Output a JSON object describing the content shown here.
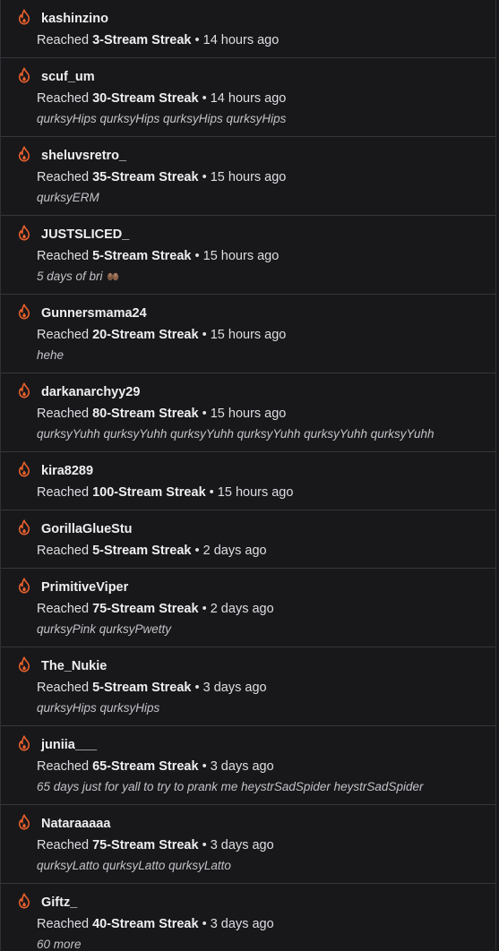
{
  "reached_label": "Reached",
  "separator": "•",
  "items": [
    {
      "username": "kashinzino",
      "streak": "3-Stream Streak",
      "time": "14 hours ago",
      "message": ""
    },
    {
      "username": "scuf_um",
      "streak": "30-Stream Streak",
      "time": "14 hours ago",
      "message": "qurksyHips qurksyHips qurksyHips qurksyHips"
    },
    {
      "username": "sheluvsretro_",
      "streak": "35-Stream Streak",
      "time": "15 hours ago",
      "message": "qurksyERM"
    },
    {
      "username": "JUSTSLICED_",
      "streak": "5-Stream Streak",
      "time": "15 hours ago",
      "message": "5 days of bri",
      "emoji": "praying-hands-emoji"
    },
    {
      "username": "Gunnersmama24",
      "streak": "20-Stream Streak",
      "time": "15 hours ago",
      "message": "hehe"
    },
    {
      "username": "darkanarchyy29",
      "streak": "80-Stream Streak",
      "time": "15 hours ago",
      "message": "qurksyYuhh qurksyYuhh qurksyYuhh qurksyYuhh qurksyYuhh qurksyYuhh"
    },
    {
      "username": "kira8289",
      "streak": "100-Stream Streak",
      "time": "15 hours ago",
      "message": ""
    },
    {
      "username": "GorillaGlueStu",
      "streak": "5-Stream Streak",
      "time": "2 days ago",
      "message": ""
    },
    {
      "username": "PrimitiveViper",
      "streak": "75-Stream Streak",
      "time": "2 days ago",
      "message": "qurksyPink qurksyPwetty"
    },
    {
      "username": "The_Nukie",
      "streak": "5-Stream Streak",
      "time": "3 days ago",
      "message": "qurksyHips qurksyHips"
    },
    {
      "username": "juniia___",
      "streak": "65-Stream Streak",
      "time": "3 days ago",
      "message": "65 days just for yall to try to prank me heystrSadSpider heystrSadSpider"
    },
    {
      "username": "Nataraaaaa",
      "streak": "75-Stream Streak",
      "time": "3 days ago",
      "message": "qurksyLatto qurksyLatto qurksyLatto"
    },
    {
      "username": "Giftz_",
      "streak": "40-Stream Streak",
      "time": "3 days ago",
      "message": "60 more"
    }
  ],
  "icon": "flame-icon",
  "colors": {
    "background": "#18181b",
    "flame": "#e8602c",
    "divider": "#35353b",
    "text": "#efeff1",
    "message": "#c3c3c8"
  }
}
